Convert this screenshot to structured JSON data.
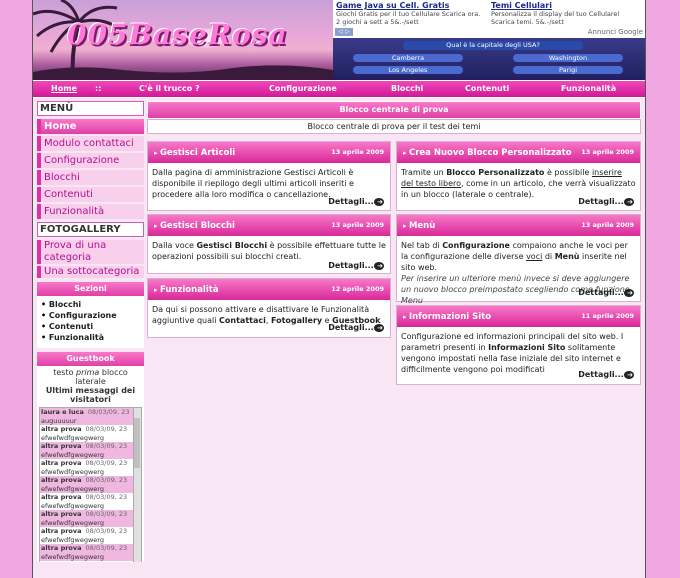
{
  "colors": {
    "accent": "#e040a8",
    "background": "#f0a8e0",
    "link": "#b01090"
  },
  "header": {
    "logo": "005BaseRosa",
    "ad1": {
      "title": "Game Java su Cell. Gratis",
      "text": "Giochi Gratis per il tuo Cellulare Scarica ora. 2 giochi a sett a 5&.-/sett"
    },
    "ad2": {
      "title": "Temi Cellulari",
      "text": "Personalizza il display del tuo Cellulare! Scarica temi. 5&.-/sett"
    },
    "google": "Annunci Google",
    "quiz": {
      "question": "Qual è la capitale degli USA?",
      "options": [
        "Camberra",
        "Washington",
        "Los Angeles",
        "Parigi"
      ]
    }
  },
  "nav": {
    "items": [
      "Home",
      "::",
      "C'è il trucco ?",
      "Configurazione",
      "Blocchi",
      "Contenuti",
      "Funzionalità"
    ]
  },
  "sidebar": {
    "menu_title": "MENÙ",
    "items": [
      "Home",
      "Modulo contattaci",
      "Configurazione",
      "Blocchi",
      "Contenuti",
      "Funzionalità"
    ],
    "gallery_title": "FOTOGALLERY",
    "gallery_items": [
      "Prova di una categoria",
      "Una sottocategoria"
    ],
    "sections_title": "Sezioni",
    "sections": [
      "Blocchi",
      "Configurazione",
      "Contenuti",
      "Funzionalità"
    ],
    "guestbook_title": "Guestbook",
    "guestbook_intro_a": "testo",
    "guestbook_intro_em": "prima",
    "guestbook_intro_b": "blocco laterale",
    "guestbook_subtitle": "Ultimi messaggi dei visitatori",
    "guestbook_entries": [
      {
        "name": "laura e luca",
        "date": "08/03/09, 23",
        "msg": "auguuuuur"
      },
      {
        "name": "altra prova",
        "date": "08/03/09, 23",
        "msg": "efwefwdfgwegwerg"
      },
      {
        "name": "altra prova",
        "date": "08/03/09, 23",
        "msg": "efwefwdfgwegwerg"
      },
      {
        "name": "altra prova",
        "date": "08/03/09, 23",
        "msg": "efwefwdfgwegwerg"
      },
      {
        "name": "altra prova",
        "date": "08/03/09, 23",
        "msg": "efwefwdfgwegwerg"
      },
      {
        "name": "altra prova",
        "date": "08/03/09, 23",
        "msg": "efwefwdfgwegwerg"
      },
      {
        "name": "altra prova",
        "date": "08/03/09, 23",
        "msg": "efwefwdfgwegwerg"
      },
      {
        "name": "altra prova",
        "date": "08/03/09, 23",
        "msg": "efwefwdfgwegwerg"
      },
      {
        "name": "altra prova",
        "date": "08/03/09, 23",
        "msg": "efwefwdfgwegwerg"
      }
    ]
  },
  "central": {
    "title": "Blocco centrale di prova",
    "text": "Blocco centrale di prova per il test dei temi"
  },
  "more_label": "Dettagli...",
  "articles": {
    "a1": {
      "title": "Gestisci Articoli",
      "date": "13 aprile 2009",
      "text": "Dalla pagina di amministrazione Gestisci Articoli è disponibile il riepilogo degli ultimi articoli inseriti e procedere alla loro modifica o cancellazione."
    },
    "a2": {
      "title": "Crea Nuovo Blocco Personalizzato",
      "date": "13 aprile 2009",
      "p1": "Tramite un ",
      "b1": "Blocco Personalizzato",
      "p2": " è possibile ",
      "u1": "inserire del testo libero",
      "p3": ", come in un articolo, che verrà visualizzato in un blocco (laterale o centrale)."
    },
    "a3": {
      "title": "Gestisci Blocchi",
      "date": "13 aprile 2009",
      "p1": "Dalla voce ",
      "b1": "Gestisci Blocchi",
      "p2": " è possibile effettuare tutte le operazioni possibili sui blocchi creati."
    },
    "a4": {
      "title": "Menù",
      "date": "13 aprile 2009",
      "p1": "Nel tab di ",
      "b1": "Configurazione",
      "p2": " compaiono anche le voci per la configurazione delle diverse ",
      "u1": "voci",
      "p3": " di ",
      "b2": "Menù",
      "p4": " inserite nel sito web.",
      "i1": "Per inserire un ulteriore menù invece si deve aggiungere un nuovo blocco preimpostato scegliendo come funzione Menu"
    },
    "a5": {
      "title": "Funzionalità",
      "date": "12 aprile 2009",
      "p1": "Da qui si possono attivare e disattivare le Funzionalità aggiuntive quali ",
      "b1": "Contattaci",
      "p2": ", ",
      "b2": "Fotogallery",
      "p3": " e ",
      "b3": "Guestbook"
    },
    "a6": {
      "title": "Informazioni Sito",
      "date": "11 aprile 2009",
      "p1": "Configurazione ed informazioni principali del sito web. I parametri presenti in ",
      "b1": "Informazioni Sito",
      "p2": " solitamente vengono impostati nella fase iniziale del sito internet e difficilmente vengono poi modificati"
    }
  }
}
